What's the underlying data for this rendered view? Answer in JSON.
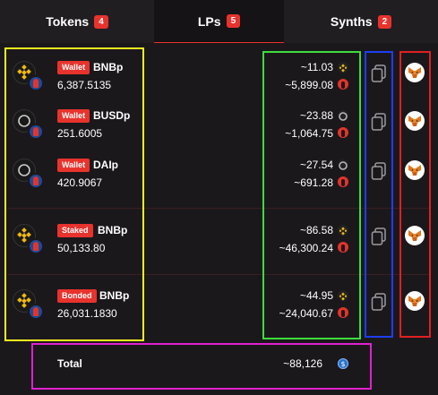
{
  "tabs": [
    {
      "label": "Tokens",
      "count": "4"
    },
    {
      "label": "LPs",
      "count": "5"
    },
    {
      "label": "Synths",
      "count": "2"
    }
  ],
  "rows": [
    {
      "badge": "Wallet",
      "name": "BNBp",
      "amount": "6,387.5135",
      "asset_value": "~11.03",
      "rune_value": "~5,899.08",
      "asset_icon": "bnb-icon"
    },
    {
      "badge": "Wallet",
      "name": "BUSDp",
      "amount": "251.6005",
      "asset_value": "~23.88",
      "rune_value": "~1,064.75",
      "asset_icon": "busd-icon"
    },
    {
      "badge": "Wallet",
      "name": "DAIp",
      "amount": "420.9067",
      "asset_value": "~27.54",
      "rune_value": "~691.28",
      "asset_icon": "dai-icon"
    },
    {
      "badge": "Staked",
      "name": "BNBp",
      "amount": "50,133.80",
      "asset_value": "~86.58",
      "rune_value": "~46,300.24",
      "asset_icon": "bnb-icon"
    },
    {
      "badge": "Bonded",
      "name": "BNBp",
      "amount": "26,031.1830",
      "asset_value": "~44.95",
      "rune_value": "~24,040.67",
      "asset_icon": "bnb-icon"
    }
  ],
  "total": {
    "label": "Total",
    "value": "~88,126",
    "icon": "usd-coin-icon"
  },
  "colors": {
    "accent_red": "#e8332d",
    "highlight_yellow": "#f5f51e",
    "highlight_green": "#3ddc3d",
    "highlight_blue": "#1e3ef0",
    "highlight_red": "#e02020",
    "highlight_magenta": "#e020d0"
  }
}
